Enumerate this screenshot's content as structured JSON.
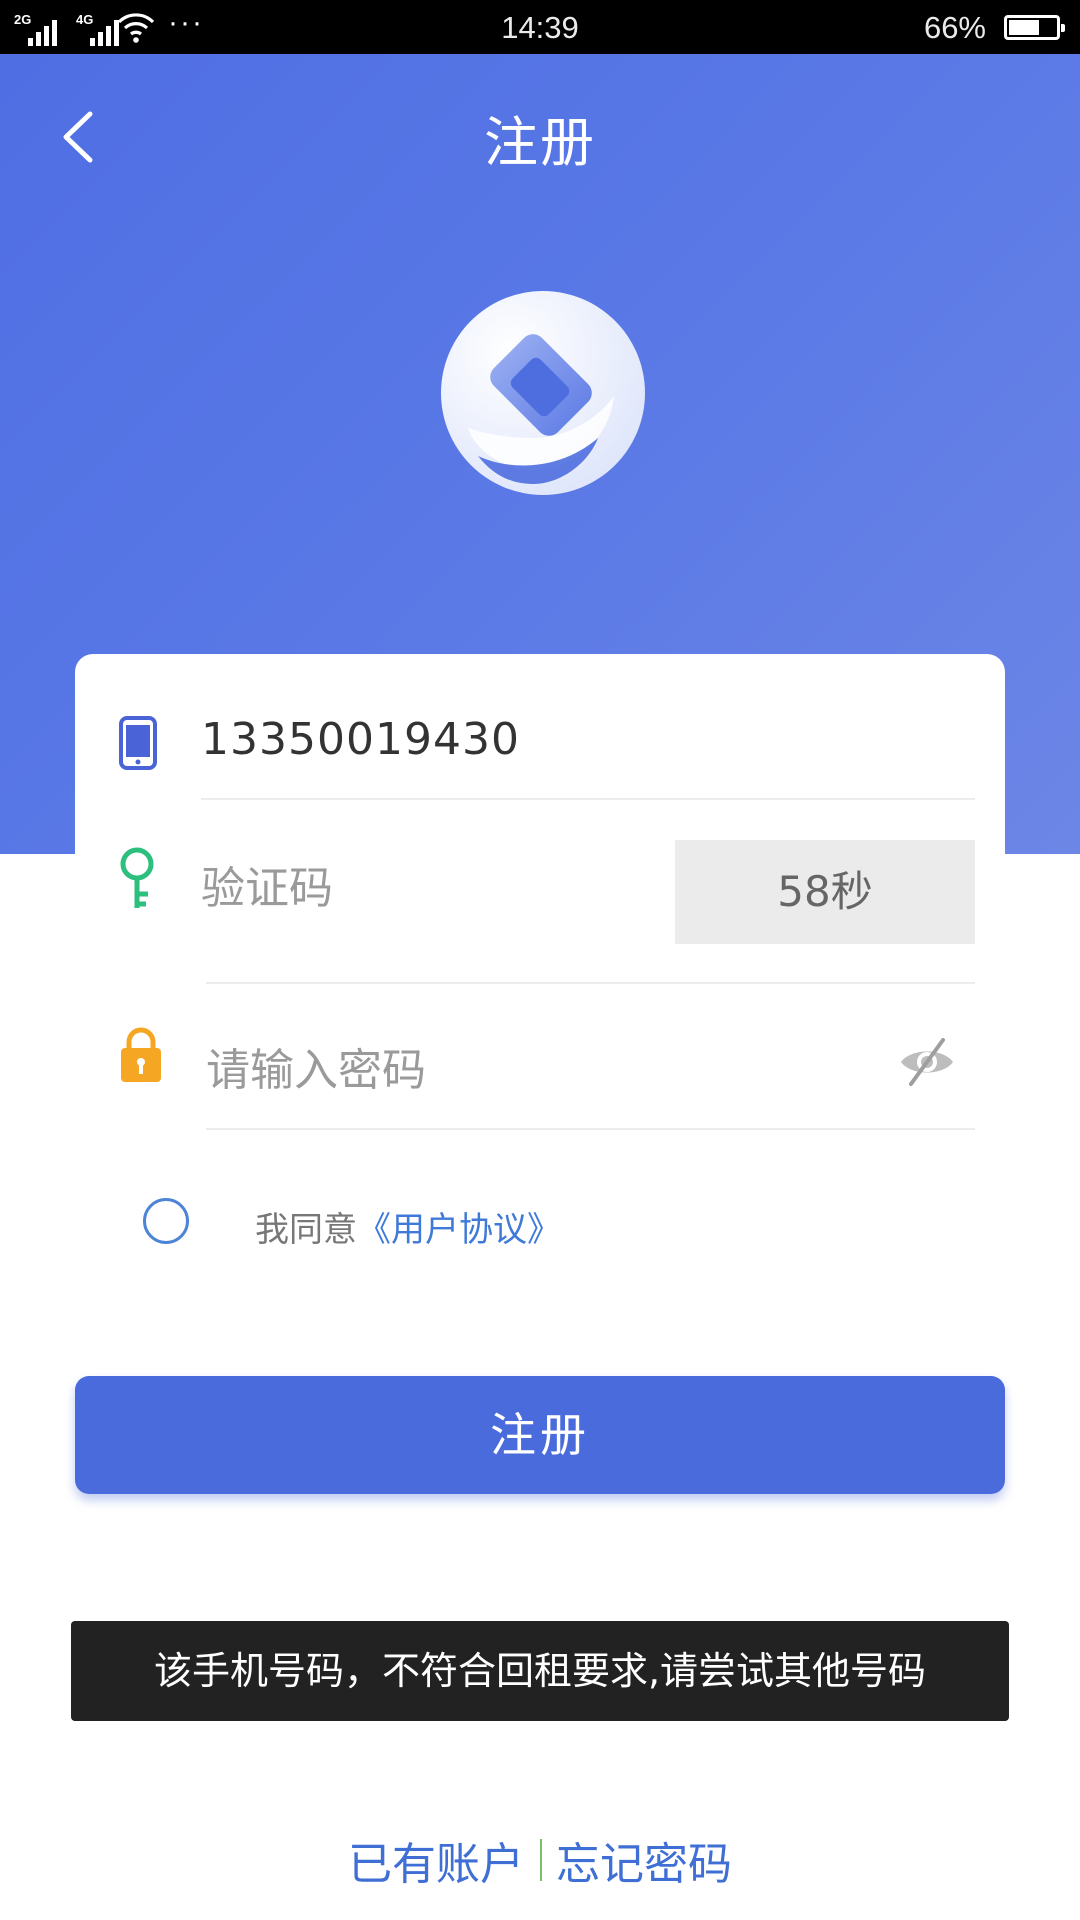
{
  "status_bar": {
    "signal1_label": "2G",
    "signal2_label": "4G",
    "more": "···",
    "time": "14:39",
    "battery_percent": "66%",
    "battery_level": 0.66,
    "icons": [
      "signal-icon",
      "wifi-icon",
      "battery-icon"
    ]
  },
  "header": {
    "title": "注册",
    "back_icon": "chevron-left-icon",
    "logo_icon": "app-logo"
  },
  "form": {
    "phone": {
      "value": "13350019430",
      "icon": "mobile-phone-icon"
    },
    "code": {
      "placeholder": "验证码",
      "countdown_label": "58秒",
      "icon": "key-icon"
    },
    "password": {
      "placeholder": "请输入密码",
      "icon": "lock-icon",
      "toggle_icon": "eye-hidden-icon"
    },
    "agreement": {
      "prefix": "我同意",
      "link": "《用户协议》"
    }
  },
  "register_button": {
    "label": "注册"
  },
  "toast": {
    "message": "该手机号码，不符合回租要求,请尝试其他号码"
  },
  "bottom_links": {
    "have_account": "已有账户",
    "forgot_password": "忘记密码"
  },
  "colors": {
    "primary": "#4a6bdc",
    "header_gradient_start": "#4f6ee3",
    "header_gradient_end": "#6c86e6",
    "link": "#3f6fd4",
    "phone_icon": "#4a63d6",
    "key_icon": "#2dbf7e",
    "lock_icon": "#f5a623"
  }
}
